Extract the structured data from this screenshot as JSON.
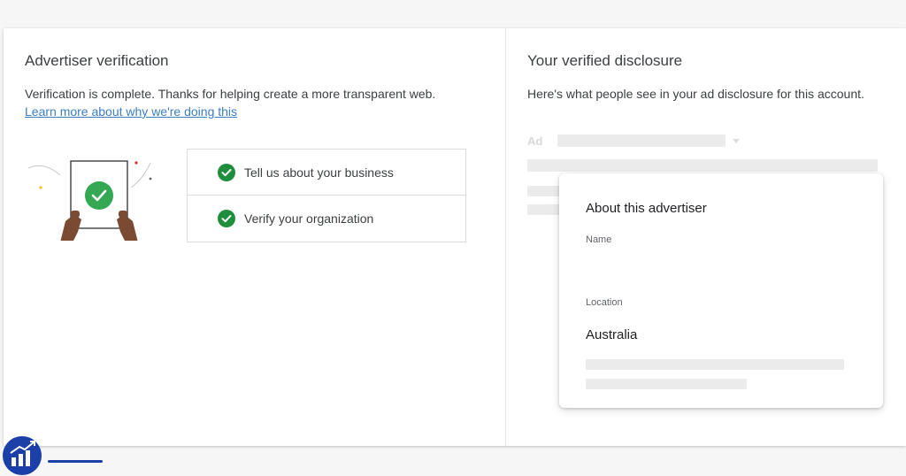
{
  "left": {
    "title": "Advertiser verification",
    "description": "Verification is complete. Thanks for helping create a more transparent web.",
    "learn_more": "Learn more about why we're doing this",
    "steps": [
      {
        "label": "Tell us about your business",
        "status": "complete"
      },
      {
        "label": "Verify your organization",
        "status": "complete"
      }
    ]
  },
  "right": {
    "title": "Your verified disclosure",
    "description": "Here's what people see in your ad disclosure for this account.",
    "ad_label": "Ad",
    "popup": {
      "title": "About this advertiser",
      "name_label": "Name",
      "location_label": "Location",
      "location_value": "Australia"
    }
  },
  "colors": {
    "check_green": "#1e8e3e",
    "link_blue": "#3b7fc4",
    "logo_blue": "#1d3fa8"
  }
}
